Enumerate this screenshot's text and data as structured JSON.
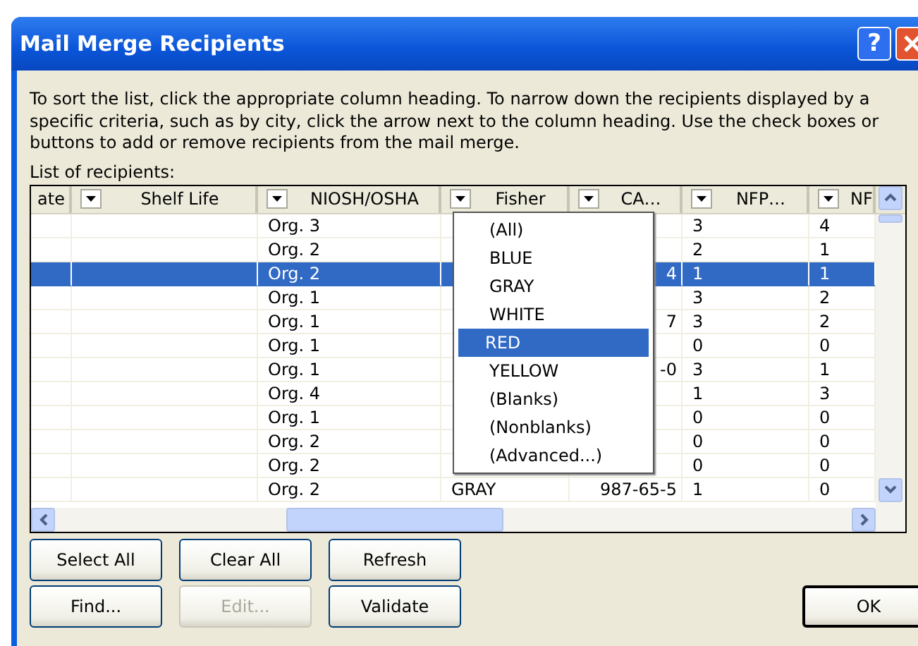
{
  "window": {
    "title": "Mail Merge Recipients",
    "help": "?"
  },
  "instructions": "To sort the list, click the appropriate column heading.  To narrow down the recipients displayed by a specific criteria, such as by city, click the arrow next to the column heading.  Use the check boxes or buttons to add or remove recipients from the mail merge.",
  "list_label": "List of recipients:",
  "table": {
    "columns": [
      {
        "label": "ate",
        "dropdown": false
      },
      {
        "label": "Shelf Life",
        "dropdown": true
      },
      {
        "label": "NIOSH/OSHA",
        "dropdown": true
      },
      {
        "label": "Fisher",
        "dropdown": true
      },
      {
        "label": "CA…",
        "dropdown": true
      },
      {
        "label": "NFP…",
        "dropdown": true
      },
      {
        "label": "NF",
        "dropdown": true
      }
    ],
    "rows": [
      {
        "selected": false,
        "cells": {
          "niosh_osha": "Org. 3",
          "nfp": "3",
          "nf": "4"
        }
      },
      {
        "selected": false,
        "cells": {
          "niosh_osha": "Org. 2",
          "nfp": "2",
          "nf": "1"
        }
      },
      {
        "selected": true,
        "cells": {
          "niosh_osha": "Org. 2",
          "cas": "4",
          "nfp": "1",
          "nf": "1"
        }
      },
      {
        "selected": false,
        "cells": {
          "niosh_osha": "Org. 1",
          "nfp": "3",
          "nf": "2"
        }
      },
      {
        "selected": false,
        "cells": {
          "niosh_osha": "Org. 1",
          "cas": "7",
          "nfp": "3",
          "nf": "2"
        }
      },
      {
        "selected": false,
        "cells": {
          "niosh_osha": "Org. 1",
          "nfp": "0",
          "nf": "0"
        }
      },
      {
        "selected": false,
        "cells": {
          "niosh_osha": "Org. 1",
          "cas": "-0",
          "nfp": "3",
          "nf": "1"
        }
      },
      {
        "selected": false,
        "cells": {
          "niosh_osha": "Org. 4",
          "nfp": "1",
          "nf": "3"
        }
      },
      {
        "selected": false,
        "cells": {
          "niosh_osha": "Org. 1",
          "nfp": "0",
          "nf": "0"
        }
      },
      {
        "selected": false,
        "cells": {
          "niosh_osha": "Org. 2",
          "nfp": "0",
          "nf": "0"
        }
      },
      {
        "selected": false,
        "cells": {
          "niosh_osha": "Org. 2",
          "nfp": "0",
          "nf": "0"
        }
      },
      {
        "selected": false,
        "cells": {
          "niosh_osha": "Org. 2",
          "fisher": "GRAY",
          "cas": "987-65-5",
          "nfp": "1",
          "nf": "0"
        }
      }
    ]
  },
  "filter_menu": {
    "items": [
      {
        "label": "(All)",
        "selected": false
      },
      {
        "label": "BLUE",
        "selected": false
      },
      {
        "label": "GRAY",
        "selected": false
      },
      {
        "label": "WHITE",
        "selected": false
      },
      {
        "label": "RED",
        "selected": true
      },
      {
        "label": "YELLOW",
        "selected": false
      },
      {
        "label": "(Blanks)",
        "selected": false
      },
      {
        "label": "(Nonblanks)",
        "selected": false
      },
      {
        "label": "(Advanced...)",
        "selected": false
      }
    ]
  },
  "buttons": [
    {
      "label": "Select All",
      "disabled": false
    },
    {
      "label": "Clear All",
      "disabled": false
    },
    {
      "label": "Refresh",
      "disabled": false
    },
    {
      "label": "Find...",
      "disabled": false
    },
    {
      "label": "Edit...",
      "disabled": true
    },
    {
      "label": "Validate",
      "disabled": false
    }
  ],
  "ok_button": "OK"
}
